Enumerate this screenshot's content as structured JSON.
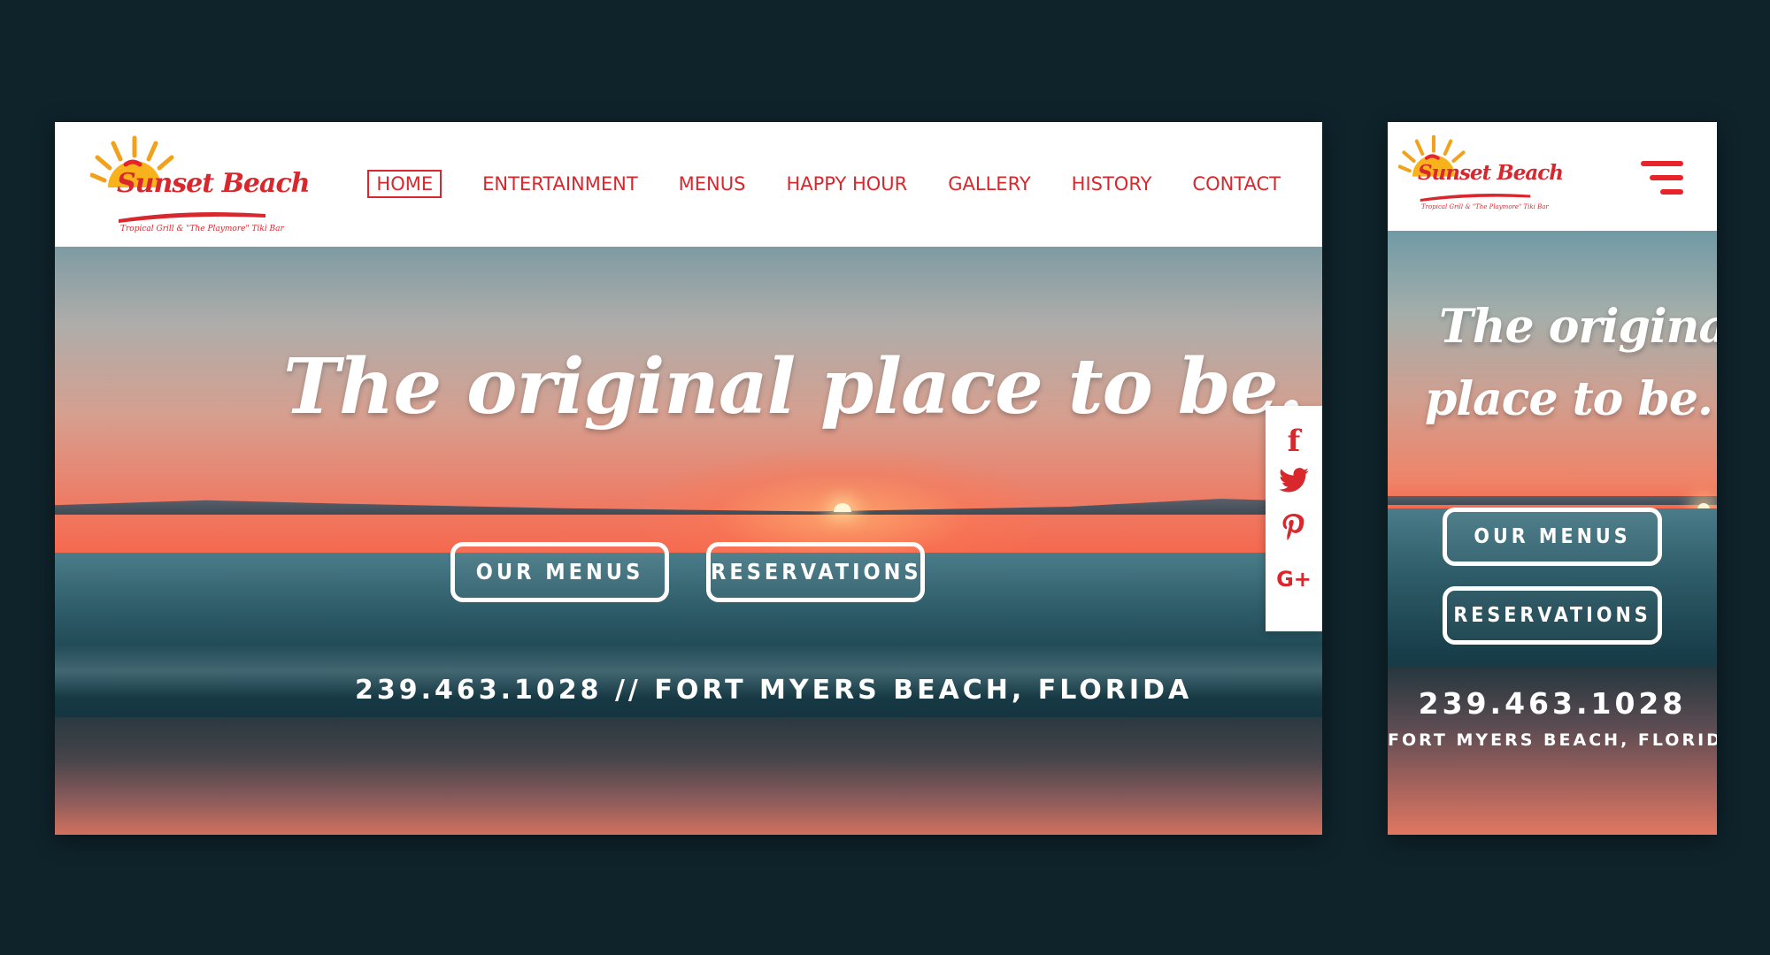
{
  "colors": {
    "brand_red": "#d9272e",
    "page_bg": "#0f232b",
    "white": "#ffffff"
  },
  "logo": {
    "name": "Sunset Beach",
    "tagline": "Tropical Grill & \"The Playmore\" Tiki Bar",
    "icon": "sun-icon"
  },
  "nav": {
    "items": [
      {
        "label": "HOME",
        "active": true
      },
      {
        "label": "ENTERTAINMENT"
      },
      {
        "label": "MENUS"
      },
      {
        "label": "HAPPY HOUR"
      },
      {
        "label": "GALLERY"
      },
      {
        "label": "HISTORY"
      },
      {
        "label": "CONTACT"
      }
    ]
  },
  "social": [
    {
      "icon": "facebook-icon",
      "glyph": "f"
    },
    {
      "icon": "twitter-icon",
      "glyph": "🐦"
    },
    {
      "icon": "pinterest-icon",
      "glyph": "P"
    },
    {
      "icon": "google-plus-icon",
      "glyph": "G+"
    }
  ],
  "hero": {
    "headline": "The original place to be.",
    "headline_line1": "The original",
    "headline_line2": "place to be.",
    "buttons": {
      "menus": "OUR MENUS",
      "reservations": "RESERVATIONS"
    },
    "contact_line": "239.463.1028 // FORT MYERS BEACH, FLORIDA",
    "phone": "239.463.1028",
    "location": "FORT MYERS BEACH, FLORIDA"
  },
  "mobile_menu_icon": "hamburger-menu-icon"
}
